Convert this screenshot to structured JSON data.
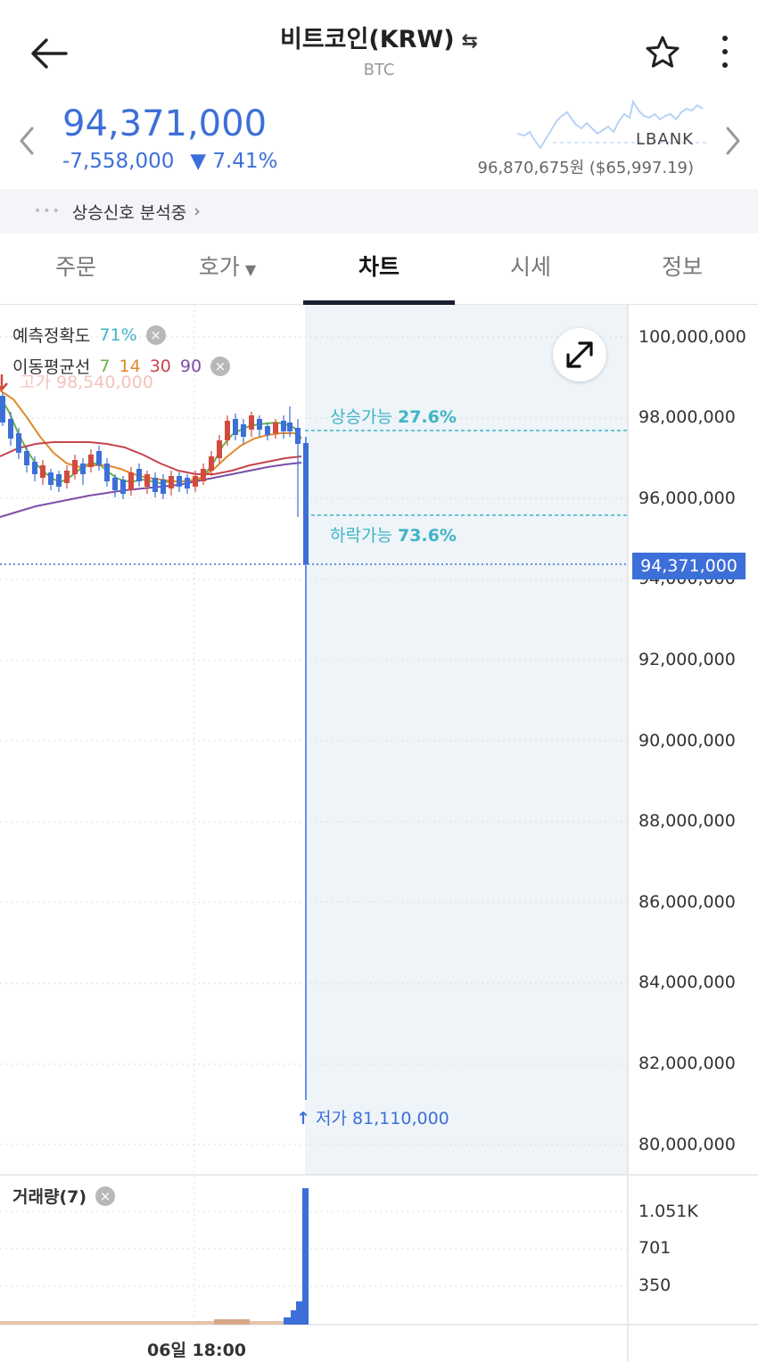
{
  "header": {
    "title": "비트코인(KRW)",
    "swap_icon": "⇆",
    "symbol": "BTC"
  },
  "price": {
    "current": "94,371,000",
    "change": "-7,558,000",
    "change_pct": "▼ 7.41%",
    "exchange_name": "LBANK",
    "exchange_price": "96,870,675원",
    "exchange_usd": "($65,997.19)",
    "color": "#3d6fd8"
  },
  "signal": {
    "dots": "•••",
    "text": "상승신호 분석중",
    "chevron": "›"
  },
  "tabs": [
    {
      "label": "주문"
    },
    {
      "label": "호가",
      "caret": "▼"
    },
    {
      "label": "차트"
    },
    {
      "label": "시세"
    },
    {
      "label": "정보"
    }
  ],
  "active_tab": "차트",
  "indicators": {
    "prediction_label": "예측정확도",
    "prediction_value": "71%",
    "ma_label": "이동평균선",
    "ma_periods": [
      {
        "value": "7",
        "color": "#6ab04c"
      },
      {
        "value": "14",
        "color": "#e08a2c"
      },
      {
        "value": "30",
        "color": "#c8434d"
      },
      {
        "value": "90",
        "color": "#7b4ea8"
      }
    ],
    "high_label": "고가 98,540,000",
    "close_icon": "×"
  },
  "forecast": {
    "up_label": "상승가능",
    "up_value": "27.6%",
    "down_label": "하락가능",
    "down_value": "73.6%"
  },
  "low_marker": "저가 81,110,000",
  "y_axis": [
    "100,000,000",
    "98,000,000",
    "96,000,000",
    "94,000,000",
    "92,000,000",
    "90,000,000",
    "88,000,000",
    "86,000,000",
    "84,000,000",
    "82,000,000",
    "80,000,000"
  ],
  "current_price_tag": "94,371,000",
  "volume": {
    "label": "거래량(7)",
    "y_axis": [
      "1.051K",
      "701",
      "350"
    ]
  },
  "time_axis_label": "06일 18:00",
  "chart_data": {
    "type": "candlestick",
    "ylim": [
      80000000,
      100000000
    ],
    "last_candle": {
      "open": 97100000,
      "high": 97300000,
      "low": 81110000,
      "close": 94371000
    },
    "forecast_up_level": 97600000,
    "forecast_down_level": 95600000,
    "up_color": "#d24b3f",
    "down_color": "#3d6fd8"
  }
}
